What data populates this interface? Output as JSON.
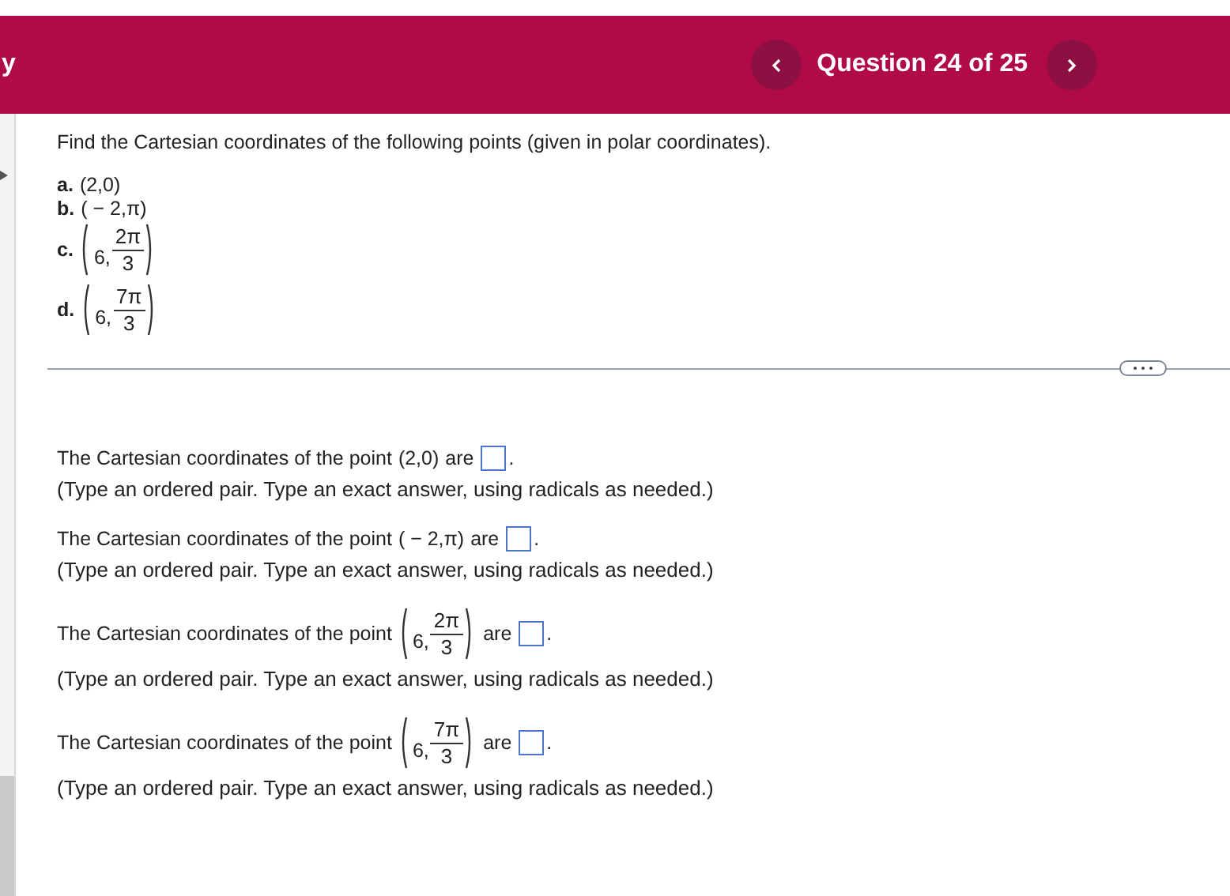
{
  "header": {
    "cut_title": "y",
    "question_title": "Question 24 of 25"
  },
  "instructions": "Find the Cartesian coordinates of the following points (given in polar coordinates).",
  "points": [
    {
      "label": "a.",
      "kind": "pair",
      "text": "(2,0)"
    },
    {
      "label": "b.",
      "kind": "pair",
      "text": "( − 2,π)"
    },
    {
      "label": "c.",
      "kind": "fraction",
      "first": "6,",
      "numerator": "2π",
      "denominator": "3"
    },
    {
      "label": "d.",
      "kind": "fraction",
      "first": "6,",
      "numerator": "7π",
      "denominator": "3"
    }
  ],
  "questions": [
    {
      "prompt": "The Cartesian coordinates of the point",
      "point": {
        "kind": "pair",
        "text": "(2,0)"
      },
      "verb": "are",
      "end": ".",
      "hint": "(Type an ordered pair. Type an exact answer, using radicals as needed.)"
    },
    {
      "prompt": "The Cartesian coordinates of the point",
      "point": {
        "kind": "pair",
        "text": "( − 2,π)"
      },
      "verb": "are",
      "end": ".",
      "hint": "(Type an ordered pair. Type an exact answer, using radicals as needed.)"
    },
    {
      "prompt": "The Cartesian coordinates of the point",
      "point": {
        "kind": "fraction",
        "first": "6,",
        "numerator": "2π",
        "denominator": "3"
      },
      "verb": "are",
      "end": ".",
      "hint": "(Type an ordered pair. Type an exact answer, using radicals as needed.)"
    },
    {
      "prompt": "The Cartesian coordinates of the point",
      "point": {
        "kind": "fraction",
        "first": "6,",
        "numerator": "7π",
        "denominator": "3"
      },
      "verb": "are",
      "end": ".",
      "hint": "(Type an ordered pair. Type an exact answer, using radicals as needed.)"
    }
  ]
}
